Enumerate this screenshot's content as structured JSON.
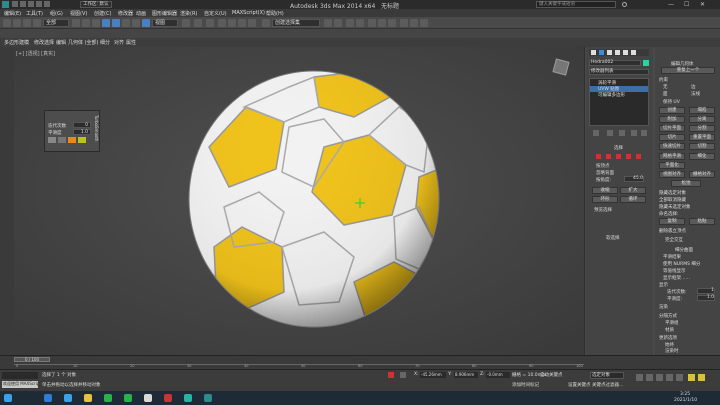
{
  "window": {
    "title": "Autodesk 3ds Max  2014 x64",
    "subtitle": "无标题",
    "search_placeholder": "键入关键字或短语"
  },
  "menu": [
    {
      "label": "编辑(E)"
    },
    {
      "label": "工具(T)"
    },
    {
      "label": "组(G)"
    },
    {
      "label": "视图(V)"
    },
    {
      "label": "创建(C)"
    },
    {
      "label": "修改器"
    },
    {
      "label": "动画"
    },
    {
      "label": "图形编辑器"
    },
    {
      "label": "渲染(R)"
    },
    {
      "label": "自定义(U)"
    },
    {
      "label": "MAXScript(X)"
    },
    {
      "label": "帮助(H)"
    }
  ],
  "toolbar": {
    "workspace": "工作区: 默认",
    "filter": "全部",
    "view": "视图",
    "selection_set": "创建选择集"
  },
  "ribbon": {
    "tabs": [
      "多边形建模",
      "修改选择",
      "编辑",
      "几何体 (全部)",
      "细分",
      "对齐",
      "属性"
    ]
  },
  "viewport": {
    "label": "[+] [透视] [真实]",
    "colors": {
      "ball_white": "#f2f2f2",
      "ball_yellow": "#f0c21a",
      "bg": "#3e3e3e"
    }
  },
  "float_panel": {
    "row1_label": "迭代次数",
    "row1_value": "0",
    "row2_label": "平滑度",
    "row2_value": "1.0",
    "side": "TurboSmooth"
  },
  "right_panel": {
    "object_name": "Hedra002",
    "modifier_list": "修改器列表",
    "stack": [
      "涡轮平滑",
      "UVW 贴图",
      "可编辑多边形"
    ],
    "selection_title": "选择",
    "checks": [
      "按顶点",
      "忽略背面",
      "按角度:"
    ],
    "angle_value": "45.0",
    "buttons": [
      "收缩",
      "扩大",
      "环形",
      "循环"
    ],
    "preview": "预览选择",
    "soft_sel": "软选择",
    "edit_geometry": "编辑几何体",
    "repeat_last": "重复上一个",
    "constraints": "约束",
    "constraint_opts": [
      "无",
      "边",
      "面",
      "法线"
    ],
    "preserve_uv": "保持 UV",
    "create": "创建",
    "collapse": "塌陷",
    "attach": "附加",
    "detach": "分离",
    "slice_plane": "切片平面",
    "split": "分割",
    "slice": "切片",
    "reset_plane": "重置平面",
    "quickslice": "快速切片",
    "cut": "切割",
    "meshsmooth": "网格平滑",
    "tessellate": "细化",
    "make_planar": "平面化",
    "view_align": "视图对齐",
    "grid_align": "栅格对齐",
    "relax": "松弛",
    "hide_sel": "隐藏选定对象",
    "unhide_all": "全部取消隐藏",
    "hide_unsel": "隐藏未选定对象",
    "named_sel": "命名选择:",
    "copy": "复制",
    "paste": "粘贴",
    "delete_iso": "删除孤立顶点",
    "full_interactivity": "完全交互",
    "subdiv_title": "细分曲面",
    "smooth_result": "平滑结果",
    "use_nurms": "使用 NURMS 细分",
    "isoline": "等值线显示",
    "show_cage": "显示框架……",
    "display": "显示",
    "iterations_label": "迭代次数:",
    "iterations_value": "1",
    "smoothness_label": "平滑度:",
    "smoothness_value": "1.0",
    "render_label": "渲染",
    "sep_by": "分隔方式",
    "smoothing_groups": "平滑组",
    "materials": "材质",
    "update_options": "更新选项",
    "always": "始终",
    "when_render": "渲染时",
    "manually": "手动",
    "update": "更新"
  },
  "timeline": {
    "frame": "0 / 100",
    "ticks": [
      "0",
      "10",
      "20",
      "30",
      "40",
      "50",
      "60",
      "70",
      "80",
      "90",
      "100"
    ]
  },
  "status": {
    "selected": "选择了 1 个 对象",
    "hint": "单击并拖动以选择并移动对象",
    "welcome": "欢迎使用 MAXScript。",
    "x_label": "X:",
    "x_value": "-45.26mm",
    "y_label": "Y:",
    "y_value": "8.906mm",
    "z_label": "Z:",
    "z_value": "-0.0mm",
    "grid": "栅格 = 10.0mm",
    "autokey": "自动关键点",
    "selected_obj": "选定对象",
    "setkey": "设置关键点",
    "keyfilter": "关键点过滤器...",
    "add_time_tag": "添加时间标记"
  },
  "taskbar": {
    "time": "3:25",
    "date": "2021/1/10"
  }
}
